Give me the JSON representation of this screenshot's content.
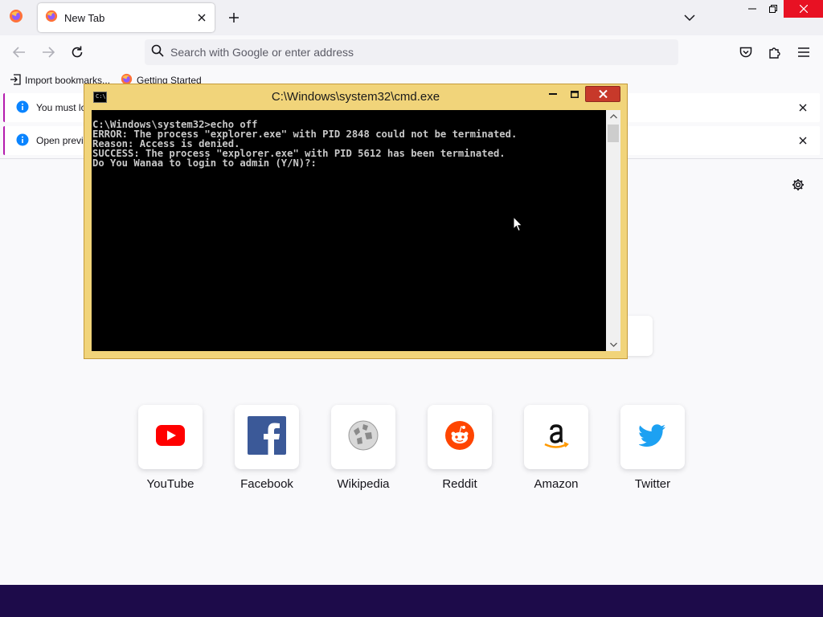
{
  "browser": {
    "tab": {
      "title": "New Tab"
    },
    "urlbar": {
      "placeholder": "Search with Google or enter address"
    },
    "bookmarks": [
      {
        "label": "Import bookmarks..."
      },
      {
        "label": "Getting Started"
      }
    ]
  },
  "notifications": [
    {
      "text": "You must lo"
    },
    {
      "text": "Open previo"
    }
  ],
  "top_sites": [
    {
      "label": "YouTube"
    },
    {
      "label": "Facebook"
    },
    {
      "label": "Wikipedia"
    },
    {
      "label": "Reddit"
    },
    {
      "label": "Amazon"
    },
    {
      "label": "Twitter"
    }
  ],
  "cmd": {
    "title": "C:\\Windows\\system32\\cmd.exe",
    "icon_text": "C:\\",
    "lines": [
      "C:\\Windows\\system32>echo off",
      "ERROR: The process \"explorer.exe\" with PID 2848 could not be terminated.",
      "Reason: Access is denied.",
      "SUCCESS: The process \"explorer.exe\" with PID 5612 has been terminated.",
      "Do You Wanaa to login to admin (Y/N)?:"
    ]
  },
  "colors": {
    "cmd_frame": "#f1d47a",
    "taskbar": "#1d0b4a",
    "notification_accent": "#b41cae",
    "info_blue": "#0a84ff"
  }
}
